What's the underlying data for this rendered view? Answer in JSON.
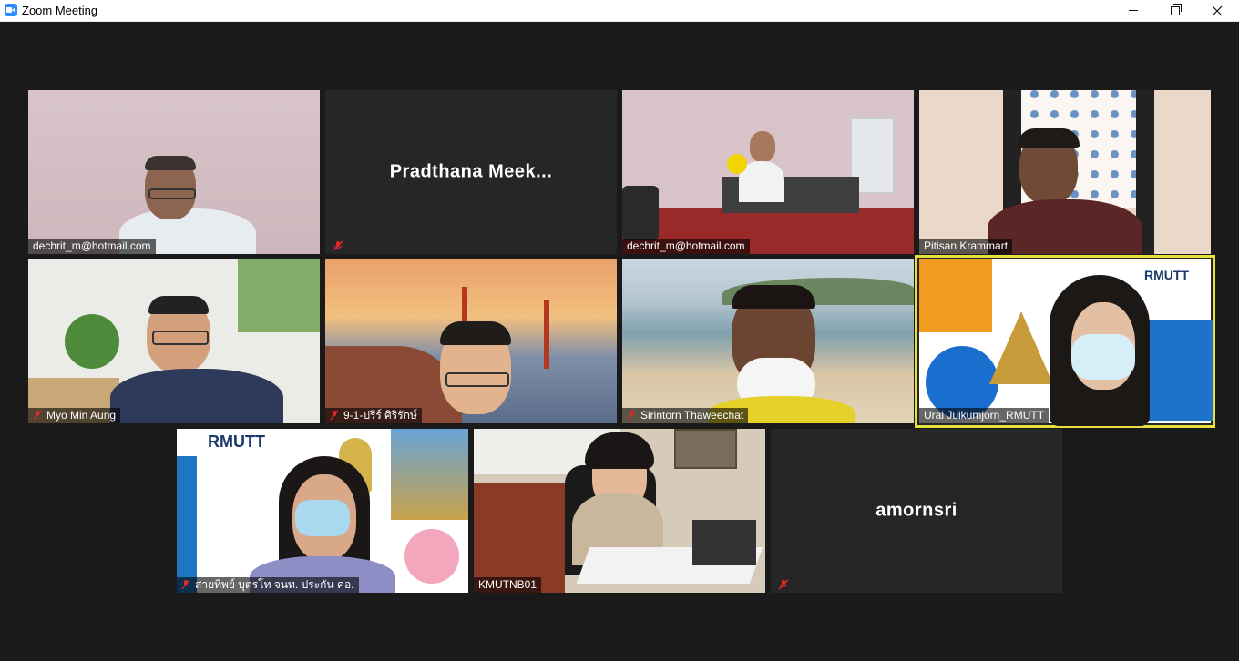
{
  "window": {
    "title": "Zoom Meeting"
  },
  "participants": [
    {
      "name": "dechrit_m@hotmail.com",
      "video": true,
      "muted": false,
      "active": false
    },
    {
      "name": "Pradthana  Meek...",
      "video": false,
      "muted": true,
      "active": false
    },
    {
      "name": "dechrit_m@hotmail.com",
      "video": true,
      "muted": false,
      "active": false
    },
    {
      "name": "Pitisan Krammart",
      "video": true,
      "muted": false,
      "active": false
    },
    {
      "name": "Myo Min Aung",
      "video": true,
      "muted": true,
      "active": false
    },
    {
      "name": "9-1-ปรีร์ ศิริรักษ์",
      "video": true,
      "muted": true,
      "active": false
    },
    {
      "name": "Sirintorn Thaweechat",
      "video": true,
      "muted": true,
      "active": false
    },
    {
      "name": "Urai Juikumjorn_RMUTT",
      "video": true,
      "muted": false,
      "active": true
    },
    {
      "name": "สายทิพย์  บุตรโท จนท. ประกัน คอ.",
      "video": true,
      "muted": true,
      "active": false
    },
    {
      "name": "KMUTNB01",
      "video": true,
      "muted": false,
      "active": false
    },
    {
      "name": "amornsri",
      "video": false,
      "muted": true,
      "active": false
    }
  ],
  "colors": {
    "active_border": "#e6e03a",
    "muted_icon": "#e02828",
    "background": "#1a1a1a"
  },
  "icons": {
    "app": "zoom-camera-icon",
    "muted": "mic-muted-icon",
    "minimize": "minimize-icon",
    "maximize": "restore-icon",
    "close": "close-icon"
  }
}
